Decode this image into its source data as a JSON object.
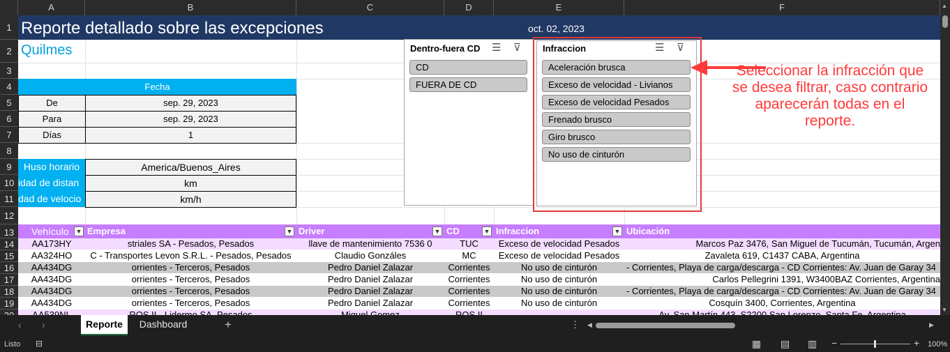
{
  "columns": [
    "A",
    "B",
    "C",
    "D",
    "E",
    "F"
  ],
  "rows": [
    "1",
    "2",
    "3",
    "4",
    "5",
    "6",
    "7",
    "8",
    "9",
    "10",
    "11",
    "12",
    "13",
    "14",
    "15",
    "16",
    "17",
    "18",
    "19",
    "20"
  ],
  "report": {
    "title": "Reporte detallado sobre las excepciones",
    "date": "oct. 02, 2023",
    "site": "Quilmes"
  },
  "params": {
    "fecha_header": "Fecha",
    "de_label": "De",
    "de_value": "sep. 29, 2023",
    "para_label": "Para",
    "para_value": "sep. 29, 2023",
    "dias_label": "Días",
    "dias_value": "1",
    "huso_label": "Huso horario",
    "huso_value": "America/Buenos_Aires",
    "dist_label": "idad de distan",
    "dist_value": "km",
    "vel_label": "dad de velocio",
    "vel_value": "km/h"
  },
  "slicer_cd": {
    "title": "Dentro-fuera CD",
    "items": [
      "CD",
      "FUERA DE CD"
    ]
  },
  "slicer_inf": {
    "title": "Infraccion",
    "items": [
      "Aceleración brusca",
      "Exceso de velocidad - Livianos",
      "Exceso de velocidad Pesados",
      "Frenado brusco",
      "Giro brusco",
      "No uso de cinturón"
    ]
  },
  "callout": "Seleccionar la infracción que se desea filtrar, caso contrario aparecerán todas en el reporte.",
  "table": {
    "headers": [
      "Vehículo",
      "Empresa",
      "Driver",
      "CD",
      "Infraccion",
      "Ubicación"
    ],
    "rows": [
      [
        "AA173HY",
        "striales SA - Pesados, Pesados",
        "llave de mantenimiento 7536 0",
        "TUC",
        "Exceso de velocidad Pesados",
        "Marcos Paz 3476, San Miguel de Tucumán, Tucumán, Argen"
      ],
      [
        "AA324HO",
        "C - Transportes Levon S.R.L. - Pesados, Pesados",
        "Claudio Gonzáles",
        "MC",
        "Exceso de velocidad Pesados",
        "Zavaleta 619, C1437 CABA, Argentina"
      ],
      [
        "AA434DG",
        "orrientes - Terceros, Pesados",
        "Pedro Daniel Zalazar",
        "Corrientes",
        "No uso de cinturón",
        "- Corrientes, Playa de carga/descarga - CD Corrientes: Av. Juan de Garay 34"
      ],
      [
        "AA434DG",
        "orrientes - Terceros, Pesados",
        "Pedro Daniel Zalazar",
        "Corrientes",
        "No uso de cinturón",
        "Carlos Pellegrini 1391, W3400BAZ Corrientes, Argentina"
      ],
      [
        "AA434DG",
        "orrientes - Terceros, Pesados",
        "Pedro Daniel Zalazar",
        "Corrientes",
        "No uso de cinturón",
        "- Corrientes, Playa de carga/descarga - CD Corrientes: Av. Juan de Garay 34"
      ],
      [
        "AA434DG",
        "orrientes - Terceros, Pesados",
        "Pedro Daniel Zalazar",
        "Corrientes",
        "No uso de cinturón",
        "Cosquín 3400, Corrientes, Argentina"
      ],
      [
        "AA539NL",
        "ROS II - Lidermo SA, Pesados",
        "Miguel Gomez",
        "ROS II",
        "",
        "Av. San Martín 443, S2200 San Lorenzo, Santa Fe, Argentina"
      ]
    ]
  },
  "tabs": [
    "Reporte",
    "Dashboard"
  ],
  "status": {
    "ready": "Listo",
    "zoom": "100%"
  },
  "colors": {
    "title_bg": "#203864",
    "accent_blue": "#00b0f0",
    "table_header": "#c77dff",
    "row_light": "#f3dcff",
    "row_grey": "#c9c9c9",
    "callout_red": "#ff3a3a"
  }
}
